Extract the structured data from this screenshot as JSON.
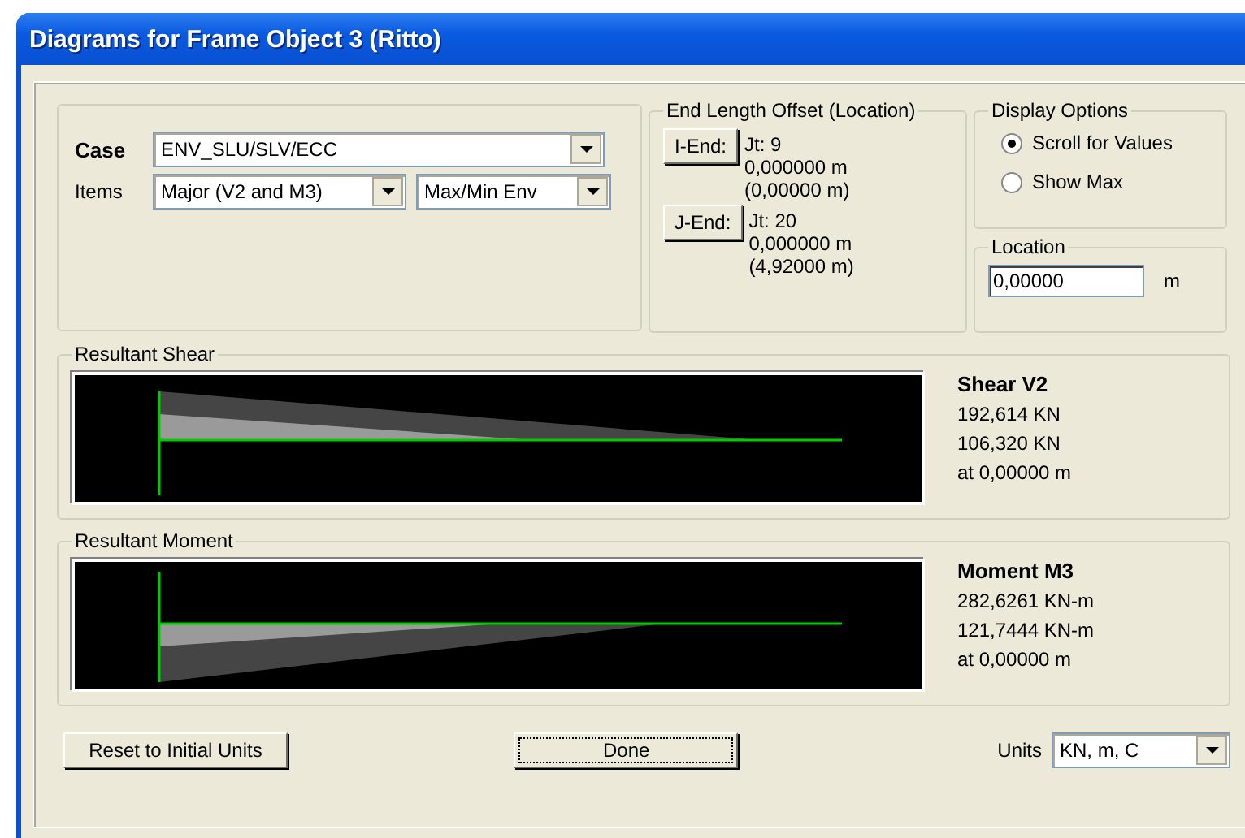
{
  "window": {
    "title": "Diagrams for Frame Object 3  (Ritto)"
  },
  "case": {
    "label": "Case",
    "value": "ENV_SLU/SLV/ECC"
  },
  "items": {
    "label": "Items",
    "component": "Major (V2 and M3)",
    "type": "Max/Min Env"
  },
  "end_offset": {
    "title": "End Length Offset (Location)",
    "ends": [
      {
        "button": "I-End:",
        "joint": "Jt:  9",
        "offset": "0,000000 m",
        "location": "(0,00000 m)"
      },
      {
        "button": "J-End:",
        "joint": "Jt:  20",
        "offset": "0,000000 m",
        "location": "(4,92000 m)"
      }
    ]
  },
  "display_options": {
    "title": "Display Options",
    "options": [
      {
        "label": "Scroll for Values",
        "selected": true
      },
      {
        "label": "Show Max",
        "selected": false
      }
    ]
  },
  "location": {
    "title": "Location",
    "value": "0,00000",
    "unit": "m"
  },
  "diagrams": [
    {
      "kind": "shear",
      "title": "Resultant Shear",
      "heading": "Shear V2",
      "lines": [
        "192,614 KN",
        "106,320 KN",
        "at 0,00000 m"
      ]
    },
    {
      "kind": "moment",
      "title": "Resultant Moment",
      "heading": "Moment M3",
      "lines": [
        "282,6261 KN-m",
        "121,7444 KN-m",
        "at 0,00000 m"
      ]
    }
  ],
  "buttons": {
    "reset": "Reset to Initial Units",
    "done": "Done"
  },
  "units": {
    "label": "Units",
    "value": "KN, m, C"
  }
}
